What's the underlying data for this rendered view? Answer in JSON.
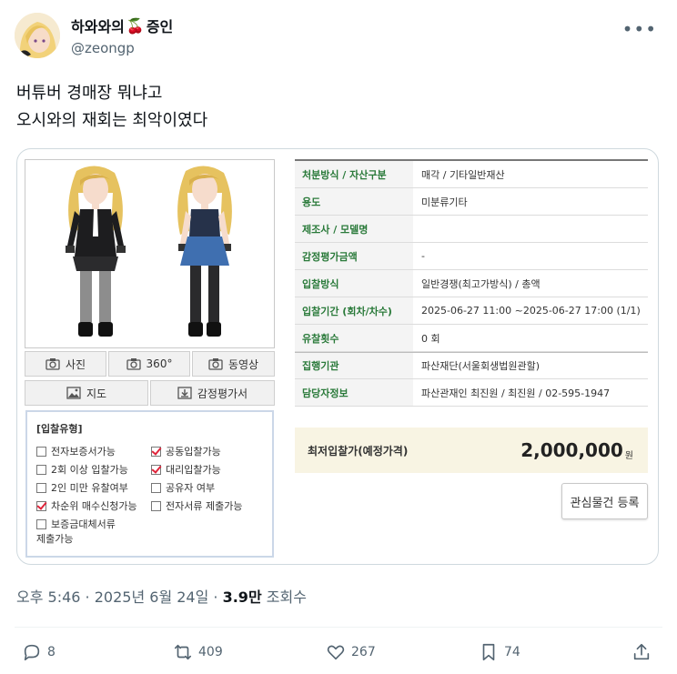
{
  "author": {
    "display_name": "하와와의",
    "display_name_emoji": "🍒",
    "display_name_suffix": "증인",
    "handle": "@zeongp"
  },
  "tweet": {
    "line1": "버튜버 경매장 뭐냐고",
    "line2": "오시와의 재회는 최악이였다"
  },
  "auction_card": {
    "media_buttons": {
      "photo": "사진",
      "view360": "360°",
      "video": "동영상",
      "map": "지도",
      "appraisal": "감정평가서"
    },
    "bid_type": {
      "title": "[입찰유형]",
      "options": [
        {
          "label": "전자보증서가능",
          "checked": false
        },
        {
          "label": "공동입찰가능",
          "checked": true
        },
        {
          "label": "2회 이상 입찰가능",
          "checked": false
        },
        {
          "label": "대리입찰가능",
          "checked": true
        },
        {
          "label": "2인 미만 유찰여부",
          "checked": false
        },
        {
          "label": "공유자 여부",
          "checked": false
        },
        {
          "label": "차순위 매수신청가능",
          "checked": true
        },
        {
          "label": "전자서류 제출가능",
          "checked": false
        }
      ],
      "last_option_line1": "보증금대체서류",
      "last_option_line2": "제출가능",
      "last_option_checked": false
    },
    "info": [
      {
        "label": "처분방식 / 자산구분",
        "value": "매각 / 기타일반재산"
      },
      {
        "label": "용도",
        "value": "미분류기타"
      },
      {
        "label": "제조사 / 모델명",
        "value": ""
      },
      {
        "label": "감정평가금액",
        "value": "-"
      },
      {
        "label": "입찰방식",
        "value": "일반경쟁(최고가방식) / 총액"
      },
      {
        "label": "입찰기간 (회차/차수)",
        "value": "2025-06-27 11:00 ~2025-06-27 17:00 (1/1)"
      },
      {
        "label": "유찰횟수",
        "value": "0 회"
      },
      {
        "label": "집행기관",
        "value": "파산재단(서울회생법원관할)"
      },
      {
        "label": "담당자정보",
        "value": "파산관재인 최진원 / 최진원 / 02-595-1947"
      }
    ],
    "min_bid_label": "최저입찰가(예정가격)",
    "min_bid_value": "2,000,000",
    "min_bid_unit": "원",
    "favorite_button": "관심물건 등록"
  },
  "meta": {
    "time": "오후 5:46",
    "sep1": " · ",
    "date": "2025년 6월 24일",
    "sep2": " · ",
    "views_count": "3.9만",
    "views_label": " 조회수"
  },
  "actions": {
    "replies": "8",
    "retweets": "409",
    "likes": "267",
    "bookmarks": "74"
  },
  "colors": {
    "label_green": "#2a7a3a",
    "check_red": "#e0243a",
    "price_bg": "#f8f4e3",
    "muted": "#536471"
  }
}
